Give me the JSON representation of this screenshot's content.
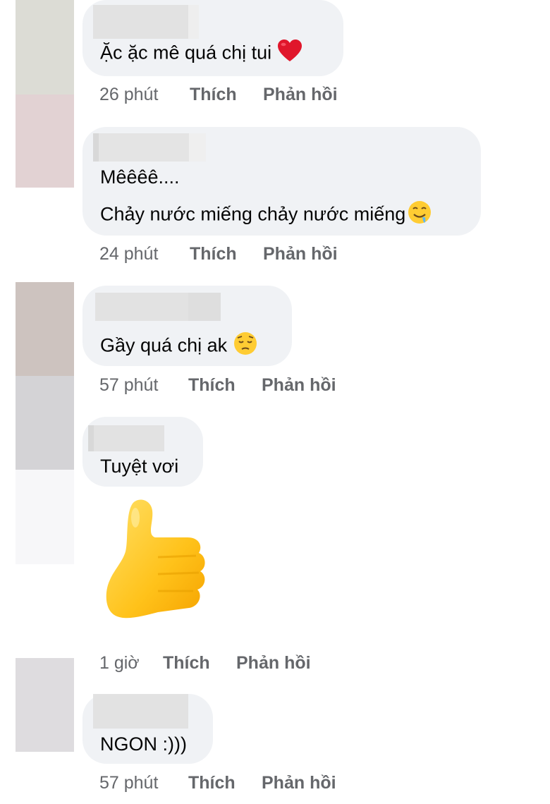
{
  "comments": [
    {
      "text_lines": [
        "Ặc ặc mê quá chị tui"
      ],
      "emoji": "red-heart",
      "time": "26 phút",
      "like": "Thích",
      "reply": "Phản hồi"
    },
    {
      "text_lines": [
        "Mêêêê....",
        "Chảy nước miếng chảy nước miếng"
      ],
      "emoji": "drooling-face",
      "time": "24 phút",
      "like": "Thích",
      "reply": "Phản hồi"
    },
    {
      "text_lines": [
        "Gầy quá chị ak"
      ],
      "emoji": "pensive-face",
      "time": "57 phút",
      "like": "Thích",
      "reply": "Phản hồi"
    },
    {
      "text_lines": [
        "Tuyệt vơi"
      ],
      "sticker": "thumbs-up",
      "time": "1 giờ",
      "like": "Thích",
      "reply": "Phản hồi"
    },
    {
      "text_lines": [
        "NGON :)))"
      ],
      "time": "57 phút",
      "like": "Thích",
      "reply": "Phản hồi"
    }
  ],
  "colors": {
    "bubble": "#f0f2f5",
    "meta_text": "#65676b",
    "blur_name": "#e4e4e4",
    "heart": "#e0162b",
    "emoji_yellow": "#ffcc33",
    "thumb_yellow": "#ffc520"
  }
}
